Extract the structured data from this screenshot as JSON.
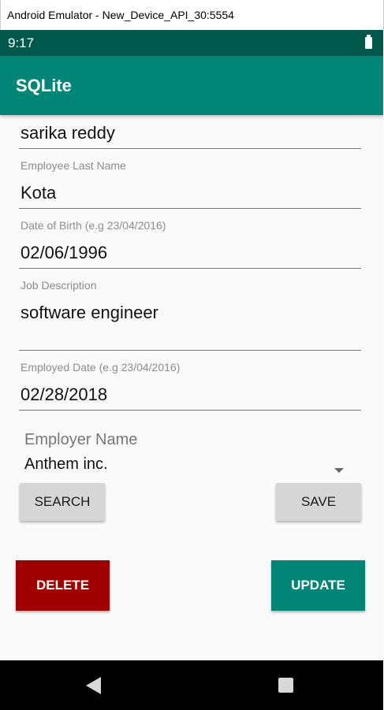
{
  "window": {
    "title": "Android Emulator - New_Device_API_30:5554"
  },
  "status_bar": {
    "time": "9:17"
  },
  "app_bar": {
    "title": "SQLite"
  },
  "form": {
    "first_name": {
      "value": "sarika reddy"
    },
    "last_name": {
      "hint": "Employee Last Name",
      "value": "Kota"
    },
    "dob": {
      "hint": "Date of Birth (e.g 23/04/2016)",
      "value": "02/06/1996"
    },
    "job": {
      "hint": "Job Description",
      "value": "software engineer"
    },
    "employed_date": {
      "hint": "Employed Date (e.g 23/04/2016)",
      "value": "02/28/2018"
    },
    "employer": {
      "label": "Employer Name",
      "selected": "Anthem inc."
    }
  },
  "buttons": {
    "search": "SEARCH",
    "save": "SAVE",
    "delete": "DELETE",
    "update": "UPDATE"
  },
  "colors": {
    "primary": "#008577",
    "primary_dark": "#00574b",
    "delete": "#a00000",
    "button_gray": "#d6d6d6"
  },
  "icons": {
    "battery": "battery-icon",
    "spinner_arrow": "chevron-down-icon",
    "back": "back-icon",
    "recents": "recents-icon"
  }
}
